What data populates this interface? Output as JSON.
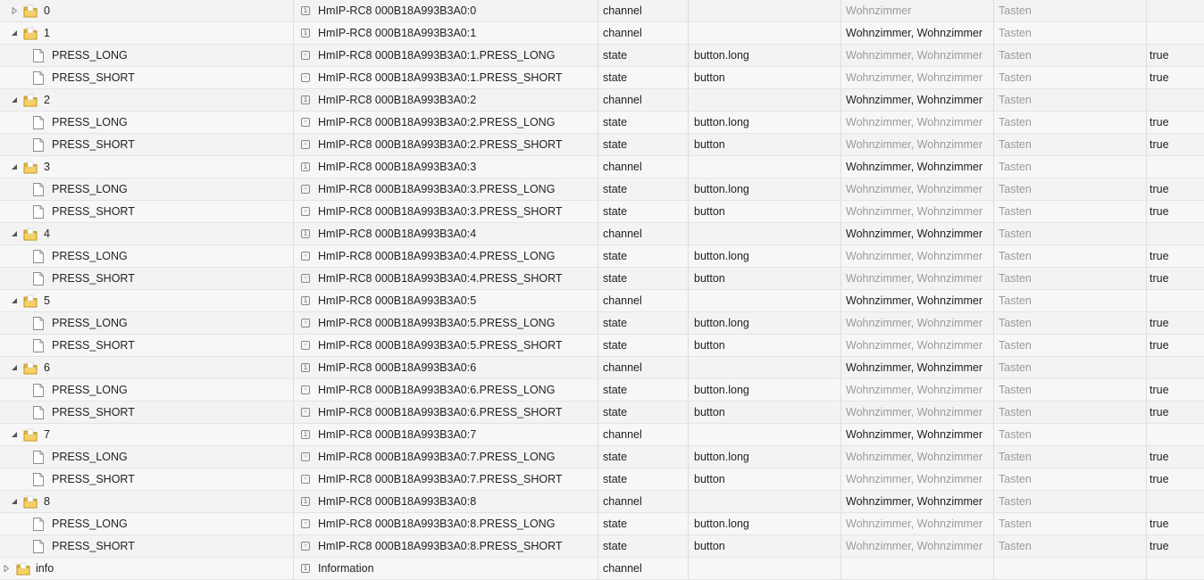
{
  "icons": {
    "folder": "folder-icon",
    "file": "file-icon",
    "expand": "triangle-expand-icon",
    "collapse": "triangle-collapse-icon",
    "channel": "channel-icon",
    "state": "state-icon"
  },
  "rows": [
    {
      "kind": "folder",
      "expanded": false,
      "level": 1,
      "name": "0",
      "id": "HmIP-RC8 000B18A993B3A0:0",
      "type": "channel",
      "role": "",
      "room": "Wohnzimmer",
      "room_dim": true,
      "func": "Tasten",
      "func_dim": true,
      "value": ""
    },
    {
      "kind": "folder",
      "expanded": true,
      "level": 1,
      "name": "1",
      "id": "HmIP-RC8 000B18A993B3A0:1",
      "type": "channel",
      "role": "",
      "room": "Wohnzimmer, Wohnzimmer",
      "room_dim": false,
      "func": "Tasten",
      "func_dim": true,
      "value": ""
    },
    {
      "kind": "state",
      "level": 2,
      "name": "PRESS_LONG",
      "id": "HmIP-RC8 000B18A993B3A0:1.PRESS_LONG",
      "type": "state",
      "role": "button.long",
      "room": "Wohnzimmer, Wohnzimmer",
      "room_dim": true,
      "func": "Tasten",
      "func_dim": true,
      "value": "true"
    },
    {
      "kind": "state",
      "level": 2,
      "name": "PRESS_SHORT",
      "id": "HmIP-RC8 000B18A993B3A0:1.PRESS_SHORT",
      "type": "state",
      "role": "button",
      "room": "Wohnzimmer, Wohnzimmer",
      "room_dim": true,
      "func": "Tasten",
      "func_dim": true,
      "value": "true"
    },
    {
      "kind": "folder",
      "expanded": true,
      "level": 1,
      "name": "2",
      "id": "HmIP-RC8 000B18A993B3A0:2",
      "type": "channel",
      "role": "",
      "room": "Wohnzimmer, Wohnzimmer",
      "room_dim": false,
      "func": "Tasten",
      "func_dim": true,
      "value": ""
    },
    {
      "kind": "state",
      "level": 2,
      "name": "PRESS_LONG",
      "id": "HmIP-RC8 000B18A993B3A0:2.PRESS_LONG",
      "type": "state",
      "role": "button.long",
      "room": "Wohnzimmer, Wohnzimmer",
      "room_dim": true,
      "func": "Tasten",
      "func_dim": true,
      "value": "true"
    },
    {
      "kind": "state",
      "level": 2,
      "name": "PRESS_SHORT",
      "id": "HmIP-RC8 000B18A993B3A0:2.PRESS_SHORT",
      "type": "state",
      "role": "button",
      "room": "Wohnzimmer, Wohnzimmer",
      "room_dim": true,
      "func": "Tasten",
      "func_dim": true,
      "value": "true"
    },
    {
      "kind": "folder",
      "expanded": true,
      "level": 1,
      "name": "3",
      "id": "HmIP-RC8 000B18A993B3A0:3",
      "type": "channel",
      "role": "",
      "room": "Wohnzimmer, Wohnzimmer",
      "room_dim": false,
      "func": "Tasten",
      "func_dim": true,
      "value": ""
    },
    {
      "kind": "state",
      "level": 2,
      "name": "PRESS_LONG",
      "id": "HmIP-RC8 000B18A993B3A0:3.PRESS_LONG",
      "type": "state",
      "role": "button.long",
      "room": "Wohnzimmer, Wohnzimmer",
      "room_dim": true,
      "func": "Tasten",
      "func_dim": true,
      "value": "true"
    },
    {
      "kind": "state",
      "level": 2,
      "name": "PRESS_SHORT",
      "id": "HmIP-RC8 000B18A993B3A0:3.PRESS_SHORT",
      "type": "state",
      "role": "button",
      "room": "Wohnzimmer, Wohnzimmer",
      "room_dim": true,
      "func": "Tasten",
      "func_dim": true,
      "value": "true"
    },
    {
      "kind": "folder",
      "expanded": true,
      "level": 1,
      "name": "4",
      "id": "HmIP-RC8 000B18A993B3A0:4",
      "type": "channel",
      "role": "",
      "room": "Wohnzimmer, Wohnzimmer",
      "room_dim": false,
      "func": "Tasten",
      "func_dim": true,
      "value": ""
    },
    {
      "kind": "state",
      "level": 2,
      "name": "PRESS_LONG",
      "id": "HmIP-RC8 000B18A993B3A0:4.PRESS_LONG",
      "type": "state",
      "role": "button.long",
      "room": "Wohnzimmer, Wohnzimmer",
      "room_dim": true,
      "func": "Tasten",
      "func_dim": true,
      "value": "true"
    },
    {
      "kind": "state",
      "level": 2,
      "name": "PRESS_SHORT",
      "id": "HmIP-RC8 000B18A993B3A0:4.PRESS_SHORT",
      "type": "state",
      "role": "button",
      "room": "Wohnzimmer, Wohnzimmer",
      "room_dim": true,
      "func": "Tasten",
      "func_dim": true,
      "value": "true"
    },
    {
      "kind": "folder",
      "expanded": true,
      "level": 1,
      "name": "5",
      "id": "HmIP-RC8 000B18A993B3A0:5",
      "type": "channel",
      "role": "",
      "room": "Wohnzimmer, Wohnzimmer",
      "room_dim": false,
      "func": "Tasten",
      "func_dim": true,
      "value": ""
    },
    {
      "kind": "state",
      "level": 2,
      "name": "PRESS_LONG",
      "id": "HmIP-RC8 000B18A993B3A0:5.PRESS_LONG",
      "type": "state",
      "role": "button.long",
      "room": "Wohnzimmer, Wohnzimmer",
      "room_dim": true,
      "func": "Tasten",
      "func_dim": true,
      "value": "true"
    },
    {
      "kind": "state",
      "level": 2,
      "name": "PRESS_SHORT",
      "id": "HmIP-RC8 000B18A993B3A0:5.PRESS_SHORT",
      "type": "state",
      "role": "button",
      "room": "Wohnzimmer, Wohnzimmer",
      "room_dim": true,
      "func": "Tasten",
      "func_dim": true,
      "value": "true"
    },
    {
      "kind": "folder",
      "expanded": true,
      "level": 1,
      "name": "6",
      "id": "HmIP-RC8 000B18A993B3A0:6",
      "type": "channel",
      "role": "",
      "room": "Wohnzimmer, Wohnzimmer",
      "room_dim": false,
      "func": "Tasten",
      "func_dim": true,
      "value": ""
    },
    {
      "kind": "state",
      "level": 2,
      "name": "PRESS_LONG",
      "id": "HmIP-RC8 000B18A993B3A0:6.PRESS_LONG",
      "type": "state",
      "role": "button.long",
      "room": "Wohnzimmer, Wohnzimmer",
      "room_dim": true,
      "func": "Tasten",
      "func_dim": true,
      "value": "true"
    },
    {
      "kind": "state",
      "level": 2,
      "name": "PRESS_SHORT",
      "id": "HmIP-RC8 000B18A993B3A0:6.PRESS_SHORT",
      "type": "state",
      "role": "button",
      "room": "Wohnzimmer, Wohnzimmer",
      "room_dim": true,
      "func": "Tasten",
      "func_dim": true,
      "value": "true"
    },
    {
      "kind": "folder",
      "expanded": true,
      "level": 1,
      "name": "7",
      "id": "HmIP-RC8 000B18A993B3A0:7",
      "type": "channel",
      "role": "",
      "room": "Wohnzimmer, Wohnzimmer",
      "room_dim": false,
      "func": "Tasten",
      "func_dim": true,
      "value": ""
    },
    {
      "kind": "state",
      "level": 2,
      "name": "PRESS_LONG",
      "id": "HmIP-RC8 000B18A993B3A0:7.PRESS_LONG",
      "type": "state",
      "role": "button.long",
      "room": "Wohnzimmer, Wohnzimmer",
      "room_dim": true,
      "func": "Tasten",
      "func_dim": true,
      "value": "true"
    },
    {
      "kind": "state",
      "level": 2,
      "name": "PRESS_SHORT",
      "id": "HmIP-RC8 000B18A993B3A0:7.PRESS_SHORT",
      "type": "state",
      "role": "button",
      "room": "Wohnzimmer, Wohnzimmer",
      "room_dim": true,
      "func": "Tasten",
      "func_dim": true,
      "value": "true"
    },
    {
      "kind": "folder",
      "expanded": true,
      "level": 1,
      "name": "8",
      "id": "HmIP-RC8 000B18A993B3A0:8",
      "type": "channel",
      "role": "",
      "room": "Wohnzimmer, Wohnzimmer",
      "room_dim": false,
      "func": "Tasten",
      "func_dim": true,
      "value": ""
    },
    {
      "kind": "state",
      "level": 2,
      "name": "PRESS_LONG",
      "id": "HmIP-RC8 000B18A993B3A0:8.PRESS_LONG",
      "type": "state",
      "role": "button.long",
      "room": "Wohnzimmer, Wohnzimmer",
      "room_dim": true,
      "func": "Tasten",
      "func_dim": true,
      "value": "true"
    },
    {
      "kind": "state",
      "level": 2,
      "name": "PRESS_SHORT",
      "id": "HmIP-RC8 000B18A993B3A0:8.PRESS_SHORT",
      "type": "state",
      "role": "button",
      "room": "Wohnzimmer, Wohnzimmer",
      "room_dim": true,
      "func": "Tasten",
      "func_dim": true,
      "value": "true"
    },
    {
      "kind": "folder",
      "expanded": false,
      "level": 0,
      "name": "info",
      "id": "Information",
      "type": "channel",
      "role": "",
      "room": "",
      "room_dim": false,
      "func": "",
      "func_dim": false,
      "value": ""
    }
  ]
}
